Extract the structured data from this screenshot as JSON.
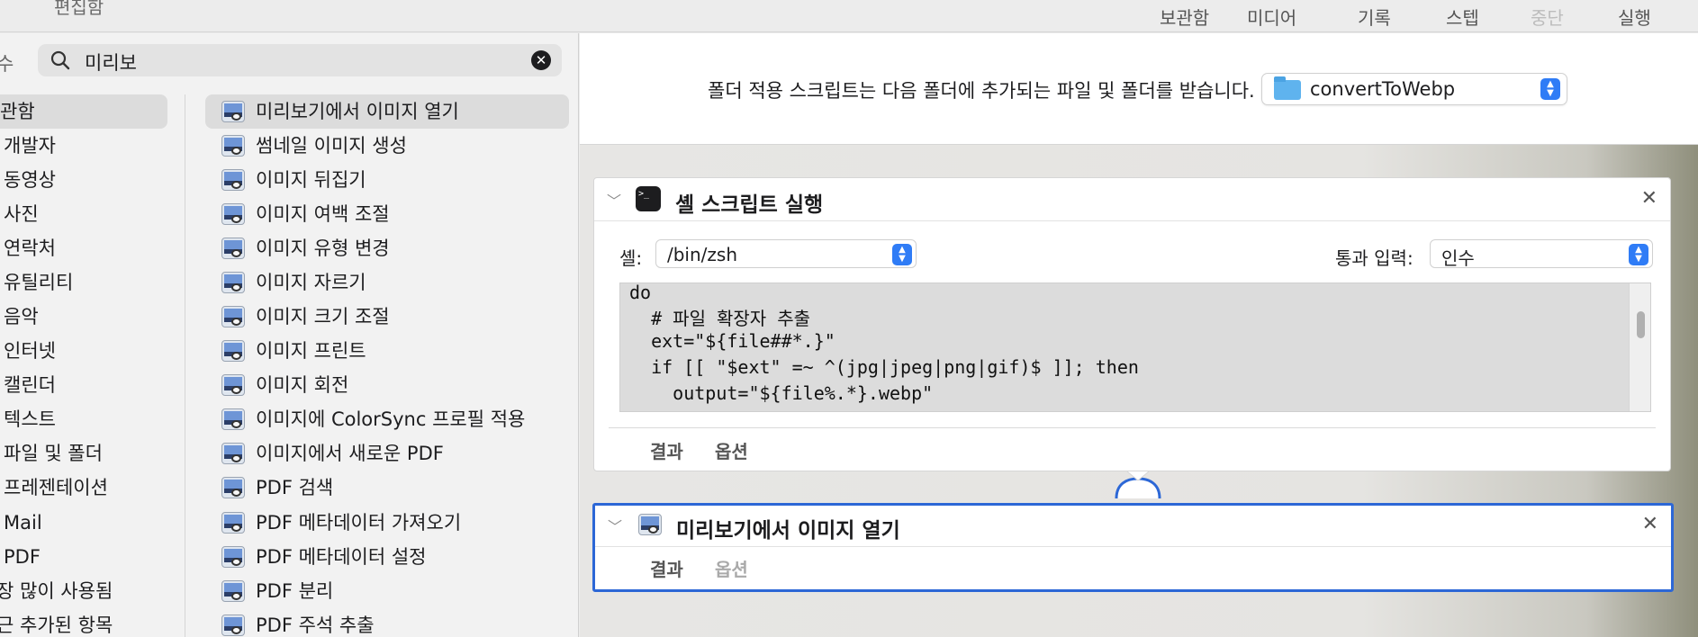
{
  "toolbar": {
    "title": "편집함",
    "items": [
      {
        "label": "보관함",
        "disabled": false
      },
      {
        "label": "미디어",
        "disabled": false
      },
      {
        "label": "기록",
        "disabled": false
      },
      {
        "label": "스텝",
        "disabled": false
      },
      {
        "label": "중단",
        "disabled": true
      },
      {
        "label": "실행",
        "disabled": false
      }
    ]
  },
  "library": {
    "search_label": "수",
    "search_value": "미리보",
    "categories": [
      {
        "label": "관함",
        "selected": true
      },
      {
        "label": "개발자"
      },
      {
        "label": "동영상"
      },
      {
        "label": "사진"
      },
      {
        "label": "연락처"
      },
      {
        "label": "유틸리티"
      },
      {
        "label": "음악"
      },
      {
        "label": "인터넷"
      },
      {
        "label": "캘린더"
      },
      {
        "label": "텍스트"
      },
      {
        "label": "파일 및 폴더"
      },
      {
        "label": "프레젠테이션"
      },
      {
        "label": "Mail"
      },
      {
        "label": "PDF"
      },
      {
        "label": "장 많이 사용됨"
      },
      {
        "label": "근 추가된 항목"
      }
    ],
    "actions": [
      {
        "label": "미리보기에서 이미지 열기",
        "selected": true
      },
      {
        "label": "썸네일 이미지 생성"
      },
      {
        "label": "이미지 뒤집기"
      },
      {
        "label": "이미지 여백 조절"
      },
      {
        "label": "이미지 유형 변경"
      },
      {
        "label": "이미지 자르기"
      },
      {
        "label": "이미지 크기 조절"
      },
      {
        "label": "이미지 프린트"
      },
      {
        "label": "이미지 회전"
      },
      {
        "label": "이미지에 ColorSync 프로필 적용"
      },
      {
        "label": "이미지에서 새로운 PDF"
      },
      {
        "label": "PDF 검색"
      },
      {
        "label": "PDF 메타데이터 가져오기"
      },
      {
        "label": "PDF 메타데이터 설정"
      },
      {
        "label": "PDF 분리"
      },
      {
        "label": "PDF 주석 추출"
      }
    ]
  },
  "workflow": {
    "folder_text": "폴더 적용 스크립트는 다음 폴더에 추가되는 파일 및 폴더를 받습니다.",
    "folder_name": "convertToWebp",
    "shell_card": {
      "title": "셸 스크립트 실행",
      "shell_label": "셸:",
      "shell_value": "/bin/zsh",
      "pass_label": "통과 입력:",
      "pass_value": "인수",
      "code_lines": [
        "do",
        "  # 파일 확장자 추출",
        "  ext=\"${file##*.}\"",
        "  if [[ \"$ext\" =~ ^(jpg|jpeg|png|gif)$ ]]; then",
        "    output=\"${file%.*}.webp\""
      ],
      "tab_results": "결과",
      "tab_options": "옵션"
    },
    "preview_card": {
      "title": "미리보기에서 이미지 열기",
      "tab_results": "결과",
      "tab_options": "옵션"
    }
  },
  "colors": {
    "accent": "#2f7cf6",
    "selection_border": "#2c67d6"
  }
}
